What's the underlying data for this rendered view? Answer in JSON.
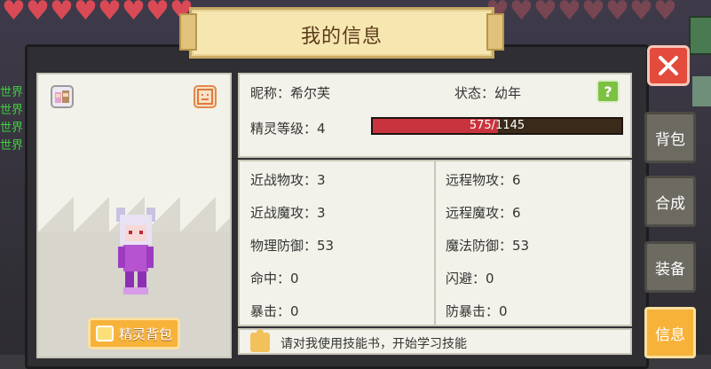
{
  "title": "我的信息",
  "close_button": "close",
  "character": {
    "pet_bag_label": "精灵背包"
  },
  "profile": {
    "nickname_label": "昵称：希尔芙",
    "status_label": "状态：幼年",
    "help_label": "?",
    "level_label": "精灵等级：4",
    "xp_text": "575/1145",
    "xp_fraction": 0.502
  },
  "stats": {
    "left": [
      "近战物攻：3",
      "近战魔攻：3",
      "物理防御：53",
      "命中：0",
      "暴击：0"
    ],
    "right": [
      "远程物攻：6",
      "远程魔攻：6",
      "魔法防御：53",
      "闪避：0",
      "防暴击：0"
    ]
  },
  "skill_tip": "请对我使用技能书，开始学习技能",
  "side_tabs": [
    "背包",
    "合成",
    "装备",
    "信息"
  ],
  "chat_prefixes": [
    "世界",
    "世界",
    "世界",
    "世界"
  ],
  "colors": {
    "xp_fill": "#c9333d",
    "active_tab": "#f7b23a",
    "close_button": "#e34b3c",
    "help_button": "#7cc142"
  }
}
